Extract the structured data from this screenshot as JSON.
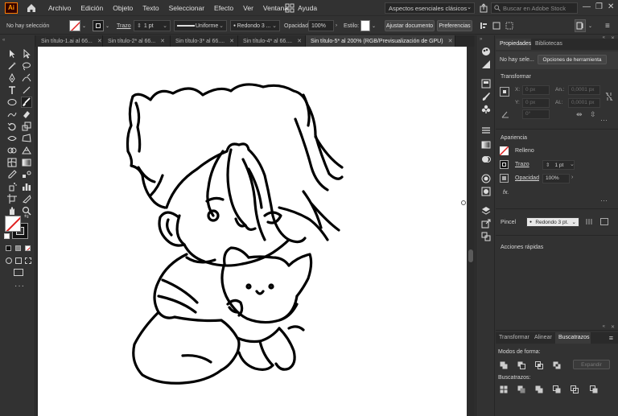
{
  "menubar": {
    "logo": "Ai",
    "items": [
      "Archivo",
      "Edición",
      "Objeto",
      "Texto",
      "Seleccionar",
      "Efecto",
      "Ver",
      "Ventana",
      "Ayuda"
    ],
    "workspace": "Aspectos esenciales clásicos",
    "search_placeholder": "Buscar en Adobe Stock",
    "window_controls": [
      "—",
      "❐",
      "✕"
    ]
  },
  "controlbar": {
    "selection": "No hay selección",
    "stroke_label": "Trazo",
    "stroke_value": "1 pt",
    "profile_label": "Uniforme",
    "brush_label": "Redondo 3 ...",
    "opacity_label": "Opacidad",
    "opacity_value": "100%",
    "style_label": "Estilo:",
    "doc_setup_btn": "Ajustar documento",
    "prefs_btn": "Preferencias"
  },
  "tabs": [
    {
      "label": "Sin título-1.ai al 66...",
      "active": false
    },
    {
      "label": "Sin título-2* al 66...",
      "active": false
    },
    {
      "label": "Sin título-3* al 66....",
      "active": false
    },
    {
      "label": "Sin título-4* al 66....",
      "active": false
    },
    {
      "label": "Sin título-5* al 200% (RGB/Previsualización de GPU)",
      "active": true
    }
  ],
  "tab_close": "✕",
  "panel": {
    "tabs": [
      "Propiedades",
      "Bibliotecas"
    ],
    "no_selection": "No hay sele...",
    "tool_options_btn": "Opciones de herramienta",
    "transform_title": "Transformar",
    "x_label": "X:",
    "y_label": "Y:",
    "w_label": "An.:",
    "h_label": "Al.:",
    "x_value": "0 px",
    "y_value": "0 px",
    "w_value": "0,0001 px",
    "h_value": "0,0001 px",
    "angle_value": "0°",
    "appearance_title": "Apariencia",
    "fill_label": "Relleno",
    "stroke_label": "Trazo",
    "stroke_value": "1 pt",
    "opacity_label": "Opacidad",
    "opacity_value": "100%",
    "fx_label": "fx.",
    "brush_label": "Pincel",
    "brush_value": "Redondo 3 pt.",
    "quick_actions": "Acciones rápidas"
  },
  "bottom_panel": {
    "tabs": [
      "Transformar",
      "Alinear",
      "Buscatrazos"
    ],
    "shape_modes": "Modos de forma:",
    "expand_btn": "Expandir",
    "pathfinders": "Buscatrazos:"
  },
  "colors": {
    "accent": "#ff9a00",
    "ui_bg": "#323232",
    "artboard": "#ffffff"
  }
}
